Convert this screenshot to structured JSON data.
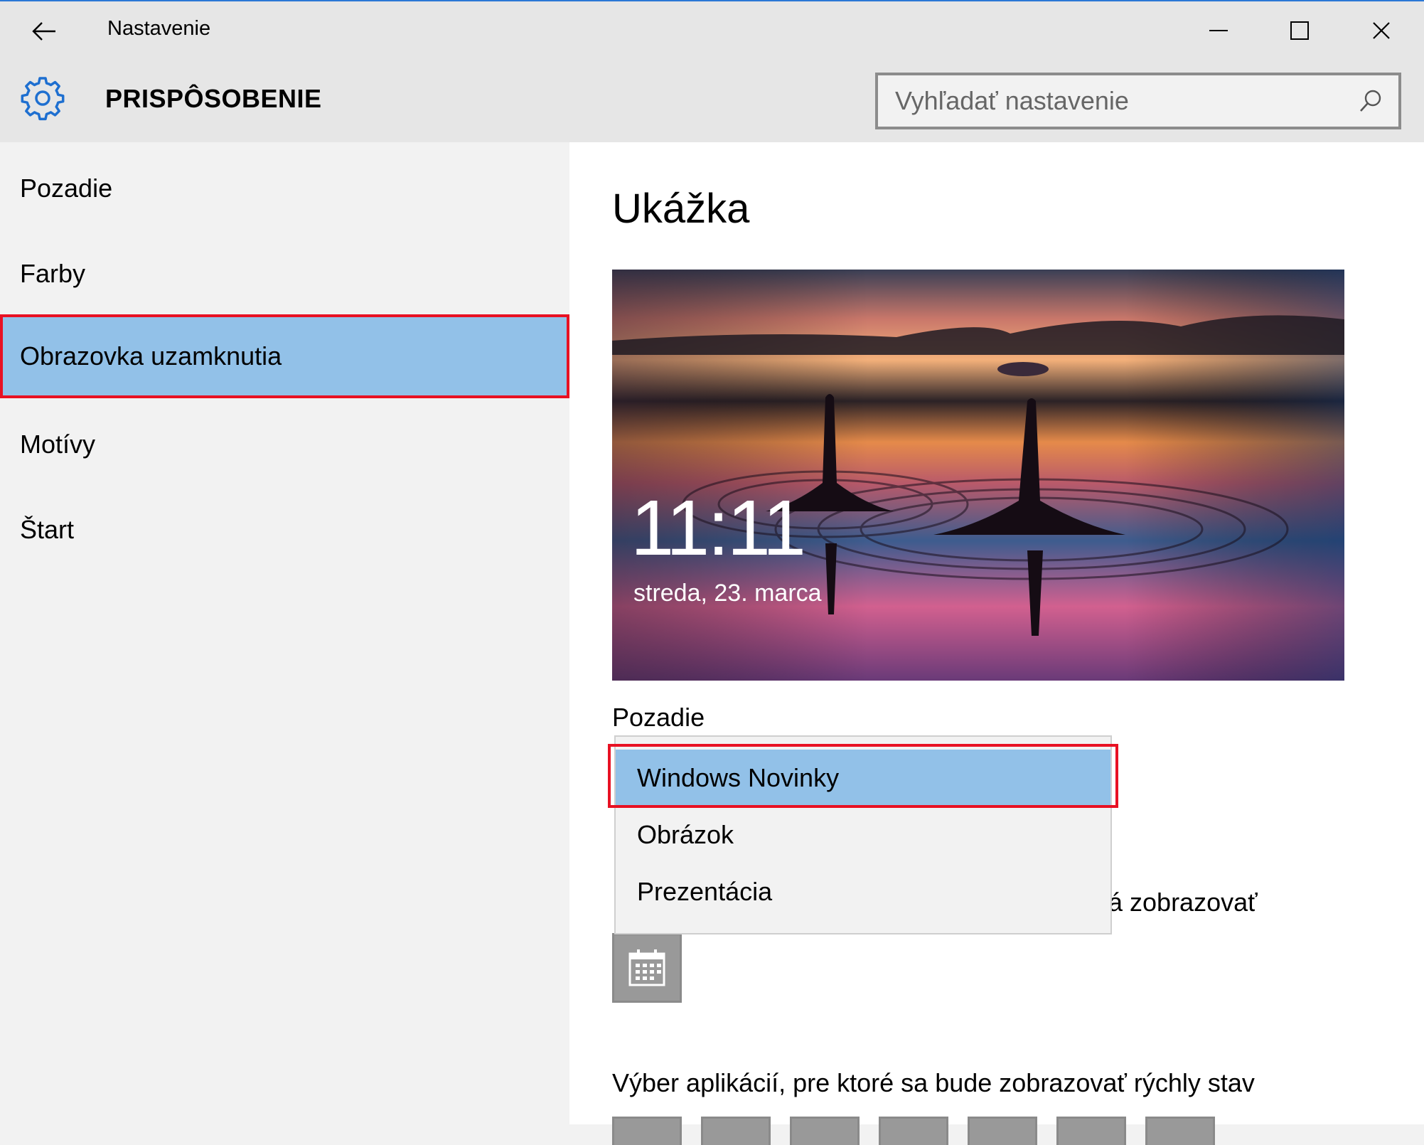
{
  "window": {
    "title": "Nastavenie"
  },
  "header": {
    "section_title": "PRISPÔSOBENIE",
    "search_placeholder": "Vyhľadať nastavenie"
  },
  "sidebar": {
    "items": [
      {
        "label": "Pozadie"
      },
      {
        "label": "Farby"
      },
      {
        "label": "Obrazovka uzamknutia",
        "selected": true
      },
      {
        "label": "Motívy"
      },
      {
        "label": "Štart"
      }
    ]
  },
  "content": {
    "preview_heading": "Ukážka",
    "preview": {
      "time": "11:11",
      "date": "streda, 23. marca"
    },
    "background_label": "Pozadie",
    "dropdown_options": [
      {
        "label": "Windows Novinky",
        "selected": true
      },
      {
        "label": "Obrázok"
      },
      {
        "label": "Prezentácia"
      }
    ],
    "partial_text": "á zobrazovať",
    "quick_status_label": "Výber aplikácií, pre ktoré sa bude zobrazovať rýchly stav"
  },
  "colors": {
    "accent": "#2b78d6",
    "selection": "#92c1e8",
    "highlight_border": "#e81123"
  },
  "icons": [
    "back-arrow-icon",
    "minimize-icon",
    "maximize-icon",
    "close-icon",
    "gear-icon",
    "search-icon",
    "calendar-icon"
  ]
}
